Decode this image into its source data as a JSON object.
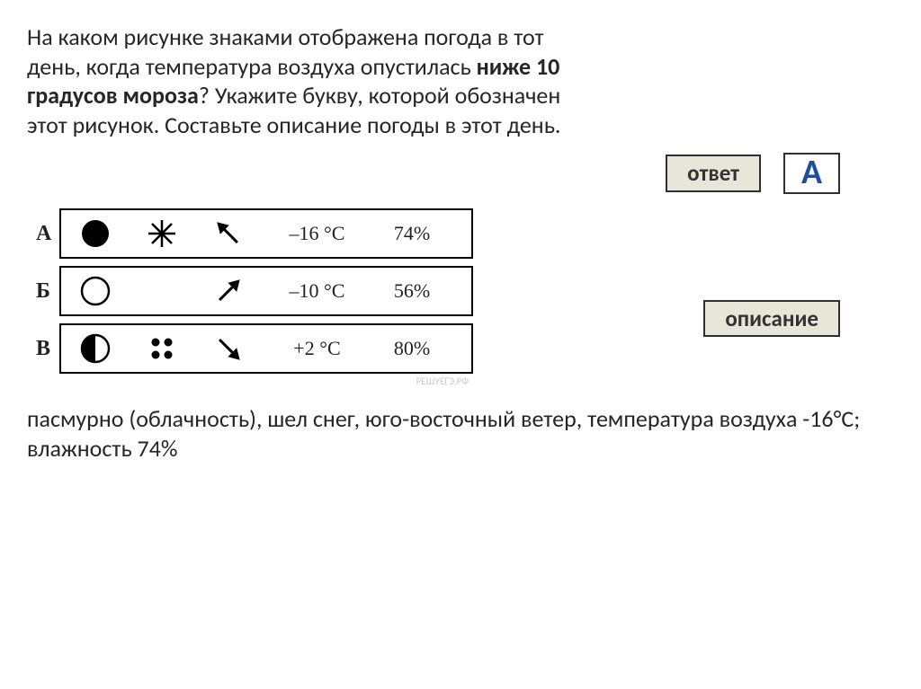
{
  "question": {
    "line1": "На каком рисунке знаками отображена погода в тот",
    "line2_a": "день, когда температура воздуха опустилась ",
    "line2_b": "ниже 10",
    "line3_a": "градусов мороза",
    "line3_b": "? Укажите букву, которой обозначен",
    "line4": "этот рисунок. Составьте описание погоды в этот день."
  },
  "labels": {
    "answer": "ответ",
    "description": "описание"
  },
  "answer_letter": "А",
  "rows": [
    {
      "label": "А",
      "cloud": "full",
      "precip": "snow",
      "arrow_deg": 315,
      "temp": "–16 °C",
      "hum": "74%"
    },
    {
      "label": "Б",
      "cloud": "empty",
      "precip": "none",
      "arrow_deg": 45,
      "temp": "–10 °C",
      "hum": "56%"
    },
    {
      "label": "В",
      "cloud": "half",
      "precip": "dots",
      "arrow_deg": 135,
      "temp": "+2 °C",
      "hum": "80%"
    }
  ],
  "watermark": "РЕШУЕГЭ.РФ",
  "description_text": "пасмурно (облачность), шел снег, юго-восточный ветер, температура воздуха -16°C; влажность 74%"
}
